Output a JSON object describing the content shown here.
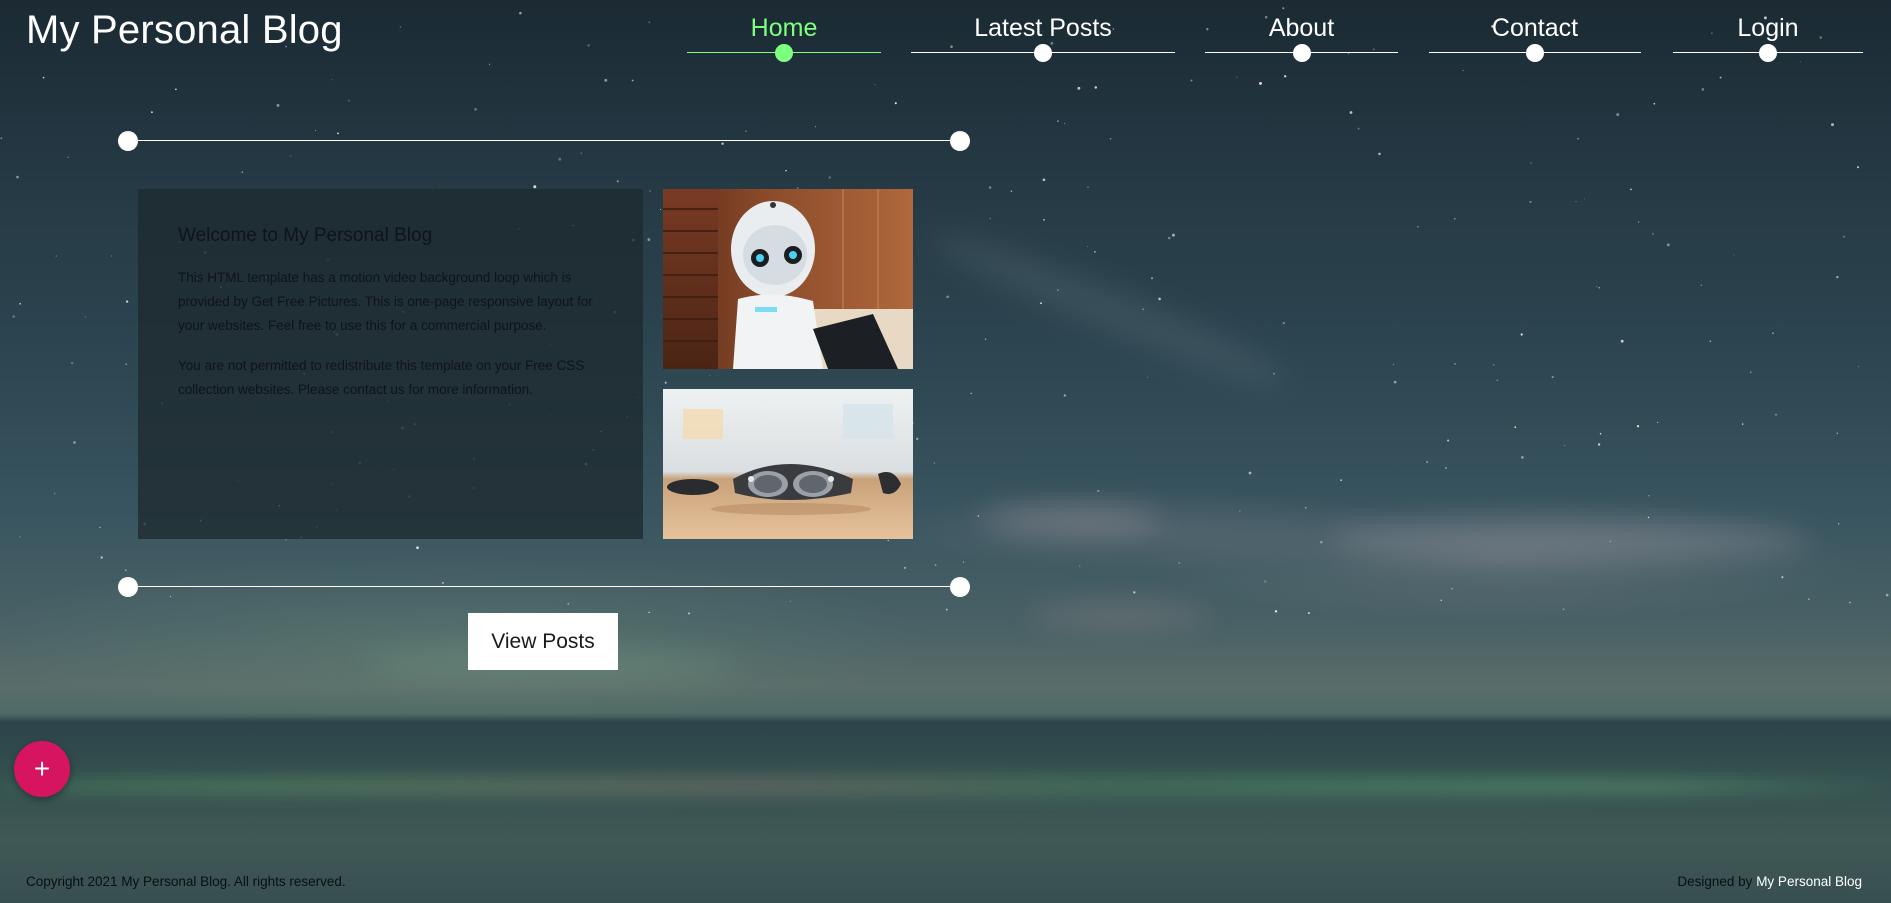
{
  "site": {
    "title": "My Personal Blog"
  },
  "nav": {
    "items": [
      {
        "label": "Home",
        "active": true
      },
      {
        "label": "Latest Posts",
        "active": false
      },
      {
        "label": "About",
        "active": false
      },
      {
        "label": "Contact",
        "active": false
      },
      {
        "label": "Login",
        "active": false
      }
    ]
  },
  "intro": {
    "heading": "Welcome to My Personal Blog",
    "paragraph_1": "This HTML template has a motion video background loop which is provided by Get Free Pictures. This is one-page responsive layout for your websites. Feel free to use this for a commercial purpose.",
    "paragraph_2": "You are not permitted to redistribute this template on your Free CSS collection websites. Please contact us for more information."
  },
  "images": {
    "robot_icon": "humanoid-robot",
    "headset_icon": "ar-headset"
  },
  "actions": {
    "view_posts_label": "View Posts",
    "fab_icon": "plus-icon",
    "fab_glyph": "+"
  },
  "footer": {
    "copyright": "Copyright 2021 My Personal Blog. All rights reserved.",
    "designed_by_prefix": "Designed by ",
    "designed_by_brand": "My Personal Blog"
  },
  "colors": {
    "nav_active": "#7eff7e",
    "fab": "#d7145f",
    "panel_bg": "#1d2a30"
  }
}
